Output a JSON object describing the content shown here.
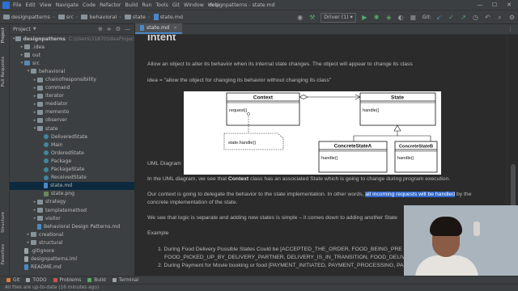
{
  "menu": {
    "items": [
      "File",
      "Edit",
      "View",
      "Navigate",
      "Code",
      "Refactor",
      "Build",
      "Run",
      "Tools",
      "Git",
      "Window",
      "Help"
    ],
    "window_title": "designpatterns - state.md",
    "window_controls": [
      "—",
      "☐",
      "✕"
    ]
  },
  "breadcrumb": [
    "designpatterns",
    "src",
    "behavioral",
    "state",
    "state.md"
  ],
  "toolbar": {
    "run_config": "Driver (1) ▾",
    "git_label": "Git:"
  },
  "left_strip": {
    "tabs": [
      "Project",
      "Pull Requests",
      "Structure",
      "Favorites"
    ]
  },
  "project_panel": {
    "title": "Project",
    "tools": [
      "⊕",
      "≑",
      "⚙",
      "—"
    ],
    "tree": [
      {
        "label": "designpatterns",
        "hint": "C:\\Users\\31870\\IdeaProjects\\de",
        "depth": 0,
        "icon": "folder",
        "arrow": "▾",
        "bold": true
      },
      {
        "label": ".idea",
        "depth": 1,
        "icon": "folder",
        "arrow": "▸"
      },
      {
        "label": "out",
        "depth": 1,
        "icon": "folder",
        "arrow": "▸"
      },
      {
        "label": "src",
        "depth": 1,
        "icon": "folder-blue",
        "arrow": "▾"
      },
      {
        "label": "behavioral",
        "depth": 2,
        "icon": "folder",
        "arrow": "▾"
      },
      {
        "label": "chainofresponsibility",
        "depth": 3,
        "icon": "folder",
        "arrow": "▸"
      },
      {
        "label": "command",
        "depth": 3,
        "icon": "folder",
        "arrow": "▸"
      },
      {
        "label": "iterator",
        "depth": 3,
        "icon": "folder",
        "arrow": "▸"
      },
      {
        "label": "mediator",
        "depth": 3,
        "icon": "folder",
        "arrow": "▸"
      },
      {
        "label": "memento",
        "depth": 3,
        "icon": "folder",
        "arrow": "▸"
      },
      {
        "label": "observer",
        "depth": 3,
        "icon": "folder",
        "arrow": "▸"
      },
      {
        "label": "state",
        "depth": 3,
        "icon": "folder",
        "arrow": "▾"
      },
      {
        "label": "DeliveredState",
        "depth": 4,
        "icon": "class",
        "arrow": ""
      },
      {
        "label": "Main",
        "depth": 4,
        "icon": "class",
        "arrow": ""
      },
      {
        "label": "OrderedState",
        "depth": 4,
        "icon": "class",
        "arrow": ""
      },
      {
        "label": "Package",
        "depth": 4,
        "icon": "class",
        "arrow": ""
      },
      {
        "label": "PackageState",
        "depth": 4,
        "icon": "class",
        "arrow": ""
      },
      {
        "label": "ReceivedState",
        "depth": 4,
        "icon": "class",
        "arrow": ""
      },
      {
        "label": "state.md",
        "depth": 4,
        "icon": "md",
        "arrow": "",
        "selected": true
      },
      {
        "label": "state.png",
        "depth": 4,
        "icon": "img",
        "arrow": ""
      },
      {
        "label": "strategy",
        "depth": 3,
        "icon": "folder",
        "arrow": "▸"
      },
      {
        "label": "templatemethod",
        "depth": 3,
        "icon": "folder",
        "arrow": "▸"
      },
      {
        "label": "visitor",
        "depth": 3,
        "icon": "folder",
        "arrow": "▸"
      },
      {
        "label": "Behavioral Design Patterns.md",
        "depth": 3,
        "icon": "md",
        "arrow": ""
      },
      {
        "label": "creational",
        "depth": 2,
        "icon": "folder",
        "arrow": "▸"
      },
      {
        "label": "structural",
        "depth": 2,
        "icon": "folder",
        "arrow": "▸"
      },
      {
        "label": ".gitignore",
        "depth": 1,
        "icon": "file",
        "arrow": ""
      },
      {
        "label": "designpatterns.iml",
        "depth": 1,
        "icon": "file",
        "arrow": ""
      },
      {
        "label": "README.md",
        "depth": 1,
        "icon": "md",
        "arrow": ""
      }
    ]
  },
  "editor_tab": {
    "label": "state.md",
    "close": "×"
  },
  "doc": {
    "heading": "Intent",
    "intent_text": "Allow an object to alter its behavior when its internal state changes. The object will appear to change its class",
    "idea_text": "idea = \"allow the object for changing its behavior without changing its class\"",
    "uml_caption": "UML Diagram",
    "p1_before": "In the UML diagram, we see that ",
    "p1_bold": "Context",
    "p1_after": " class has an associated State which is going to change during program execution.",
    "p2_before": "Our context is going to delegate the behavior to the state implementation. In other words, ",
    "p2_highlight": "all incoming requests will be handled",
    "p2_after": " by the",
    "p2_line2": "concrete implementation of the state.",
    "p3": "We see that logic is separate and adding new states is simple – it comes down to adding another State",
    "example_label": "Example",
    "list_item1_line1": "1. During Food Delivery Possible States Could be [ACCEPTED_THE_ORDER, FOOD_BEING_PRE",
    "list_item1_line2": "FOOD_PICKED_UP_BY_DELIVERY_PARTNER, DELIVERY_IS_IN_TRANSITION, FOOD_DELIV",
    "list_item2": "2. During Payment for Movie booking or food [PAYMENT_INITIATED, PAYMENT_PROCESSING, PA"
  },
  "uml": {
    "context_title": "Context",
    "context_method": "request()",
    "state_title": "State",
    "state_method": "handle()",
    "note_text": "state.handle()",
    "concrete_a_title": "ConcreteStateA",
    "concrete_a_method": "handle()",
    "concrete_b_title": "ConcreteStateB",
    "concrete_b_method": "handle()"
  },
  "bottom_tools": [
    "Git",
    "TODO",
    "Problems",
    "Build",
    "Terminal"
  ],
  "status": "All files are up-to-date (16 minutes ago)"
}
